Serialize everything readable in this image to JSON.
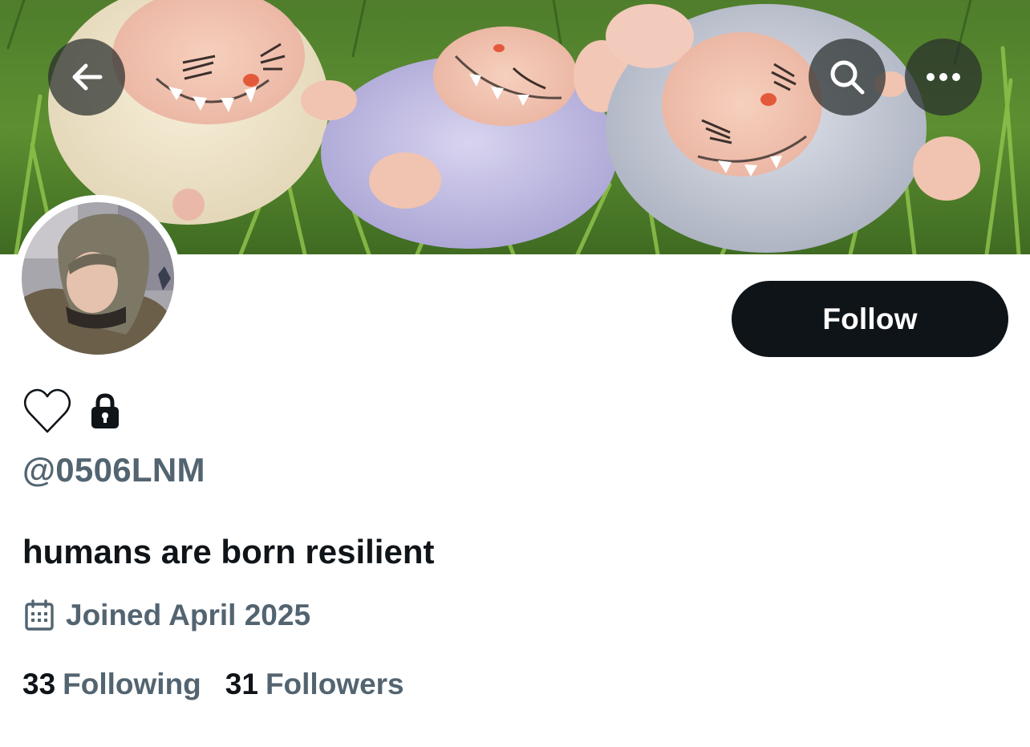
{
  "profile": {
    "handle": "@0506LNM",
    "bio": "humans are born resilient",
    "joined": "Joined April 2025",
    "following_count": "33",
    "following_label": "Following",
    "followers_count": "31",
    "followers_label": "Followers"
  },
  "actions": {
    "follow_label": "Follow"
  },
  "icons": {
    "back": "arrow-left-icon",
    "search": "search-icon",
    "more": "more-horizontal-icon",
    "name_emoji": "heart-outline-icon",
    "protected": "lock-icon",
    "joined": "calendar-icon"
  },
  "colors": {
    "primary_text": "#0f1419",
    "secondary_text": "#536471",
    "follow_button_bg": "#0f1419",
    "follow_button_text": "#ffffff",
    "overlay_button_bg": "#2e3431"
  }
}
